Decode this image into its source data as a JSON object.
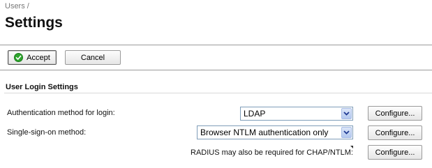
{
  "breadcrumb": "Users /",
  "page_title": "Settings",
  "toolbar": {
    "accept_label": "Accept",
    "cancel_label": "Cancel"
  },
  "section": {
    "title": "User Login Settings"
  },
  "rows": {
    "auth_method": {
      "label": "Authentication method for login:",
      "selected": "LDAP",
      "configure_label": "Configure..."
    },
    "sso_method": {
      "label": "Single-sign-on method:",
      "selected": "Browser NTLM authentication only",
      "configure_label": "Configure..."
    },
    "radius": {
      "label": "RADIUS may also be required for CHAP/NTLM:",
      "configure_label": "Configure..."
    }
  },
  "colors": {
    "accept_icon": "#2da52d",
    "select_border": "#7f9db9",
    "dropdown_arrow": "#1f3a93"
  }
}
